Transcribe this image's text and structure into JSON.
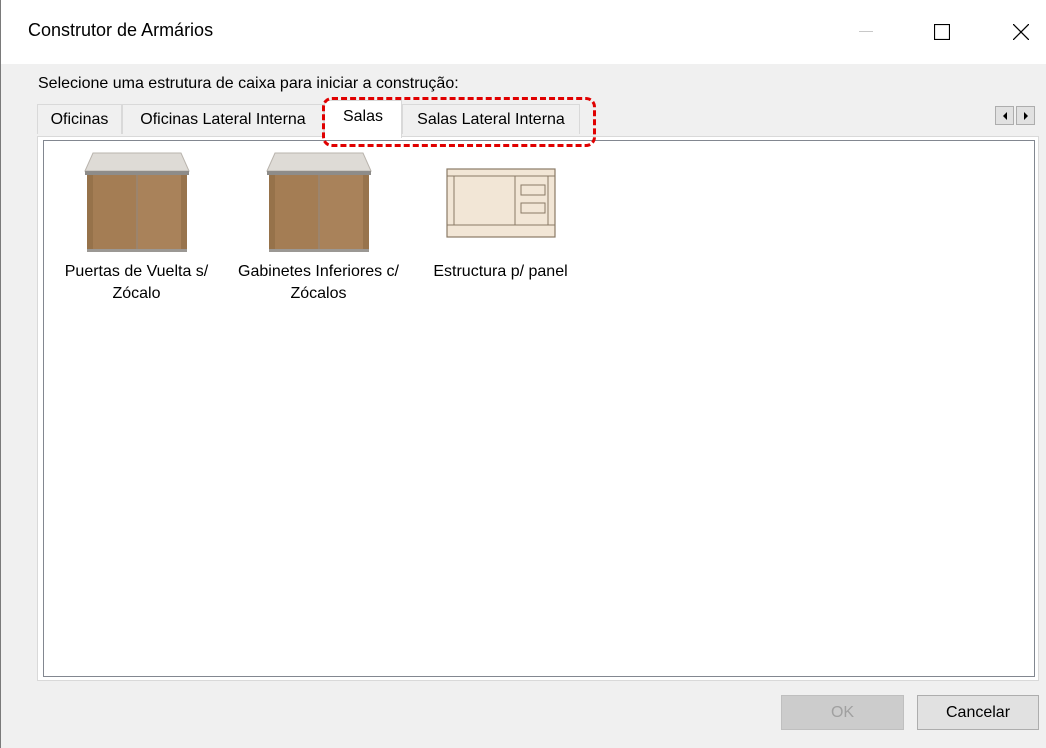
{
  "window": {
    "title": "Construtor de Armários"
  },
  "instruction": "Selecione uma estrutura de caixa para iniciar a construção:",
  "tabs": [
    {
      "label": "Oficinas",
      "selected": false
    },
    {
      "label": "Oficinas Lateral Interna",
      "selected": false
    },
    {
      "label": "Salas",
      "selected": true
    },
    {
      "label": "Salas Lateral Interna",
      "selected": false
    }
  ],
  "items": [
    {
      "label": "Puertas de Vuelta s/ Zócalo",
      "icon": "cabinet-two-doors-icon"
    },
    {
      "label": "Gabinetes Inferiores c/ Zócalos",
      "icon": "cabinet-two-doors-icon"
    },
    {
      "label": "Estructura p/ panel",
      "icon": "panel-structure-icon"
    }
  ],
  "buttons": {
    "ok_label": "OK",
    "cancel_label": "Cancelar"
  },
  "colors": {
    "highlight": "#e00000",
    "wood": "#a9825a",
    "panel_fill": "#f2e6d6"
  }
}
